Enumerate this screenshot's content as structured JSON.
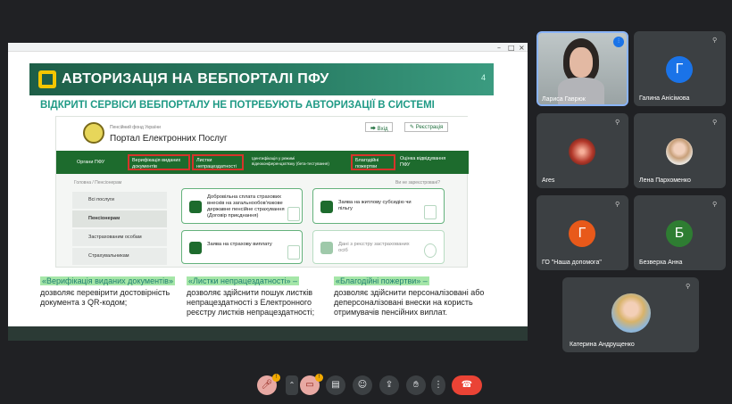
{
  "slide": {
    "title": "АВТОРИЗАЦІЯ НА ВЕБПОРТАЛІ ПФУ",
    "page_number": "4",
    "subtitle": "ВІДКРИТІ СЕРВІСИ ВЕБПОРТАЛУ НЕ ПОТРЕБУЮТЬ АВТОРИЗАЦІЇ В СИСТЕМІ",
    "portal": {
      "org_small": "Пенсійний фонд України",
      "name": "Портал Електронних Послуг",
      "login": "Вхід",
      "register": "Реєстрація",
      "nav": [
        "Органи ПФУ",
        "Верифікація виданих документів",
        "Листки непрацездатності",
        "Ідентифікація у режимі відеоконференцзв'язку (бета-тестування)",
        "Благодійні пожертви",
        "Оцінка відвідування ПФУ"
      ],
      "breadcrumb": "Головна / Пенсіонерам",
      "not_registered": "Ви не зареєстровані?",
      "menu": [
        "Всі послуги",
        "Пенсіонерам",
        "Застрахованим особам",
        "Страхувальникам"
      ],
      "cards": [
        "Добровільна сплата страхових внесків на загальнообов'язкове державне пенсійне страхування (Договір приєднання)",
        "Заява на житлову субсидію чи пільгу",
        "Заява на страхову виплату",
        "Дані з реєстру застрахованих осіб"
      ]
    },
    "captions": [
      {
        "title": "«Верифікація виданих документів»",
        "body": "дозволяє перевірити достовірність документа з QR-кодом;"
      },
      {
        "title": "«Листки непрацездатності» –",
        "body": "дозволяє здійснити пошук листків непрацездатності з Електронного реєстру листків непрацездатності;"
      },
      {
        "title": "«Благодійні пожертви» –",
        "body": "дозволяє здійснити персоналізовані або деперсоналізовані внески на користь отримувачів пенсійних виплат."
      }
    ]
  },
  "participants": [
    {
      "name": "Лариса Гаврюк",
      "type": "video"
    },
    {
      "name": "Галина Анісімова",
      "initial": "Г",
      "color": "#1a73e8"
    },
    {
      "name": "Ares",
      "type": "photo"
    },
    {
      "name": "Лена Пархоменко",
      "type": "photo"
    },
    {
      "name": "ГО \"Наша допомога\"",
      "initial": "Г",
      "color": "#e8591a"
    },
    {
      "name": "Безверха Анна",
      "initial": "Б",
      "color": "#2e7d32"
    },
    {
      "name": "Катерина Андрущенко",
      "type": "photo"
    }
  ],
  "toolbar": {
    "mic_badge": "!",
    "cam_badge": "!"
  },
  "icons": {
    "pin": "pin-icon",
    "mic": "mic-off-icon",
    "camera": "camera-off-icon",
    "captions": "captions-icon",
    "emoji": "emoji-icon",
    "present": "present-icon",
    "hand": "raise-hand-icon",
    "more": "more-icon",
    "leave": "leave-call-icon"
  }
}
